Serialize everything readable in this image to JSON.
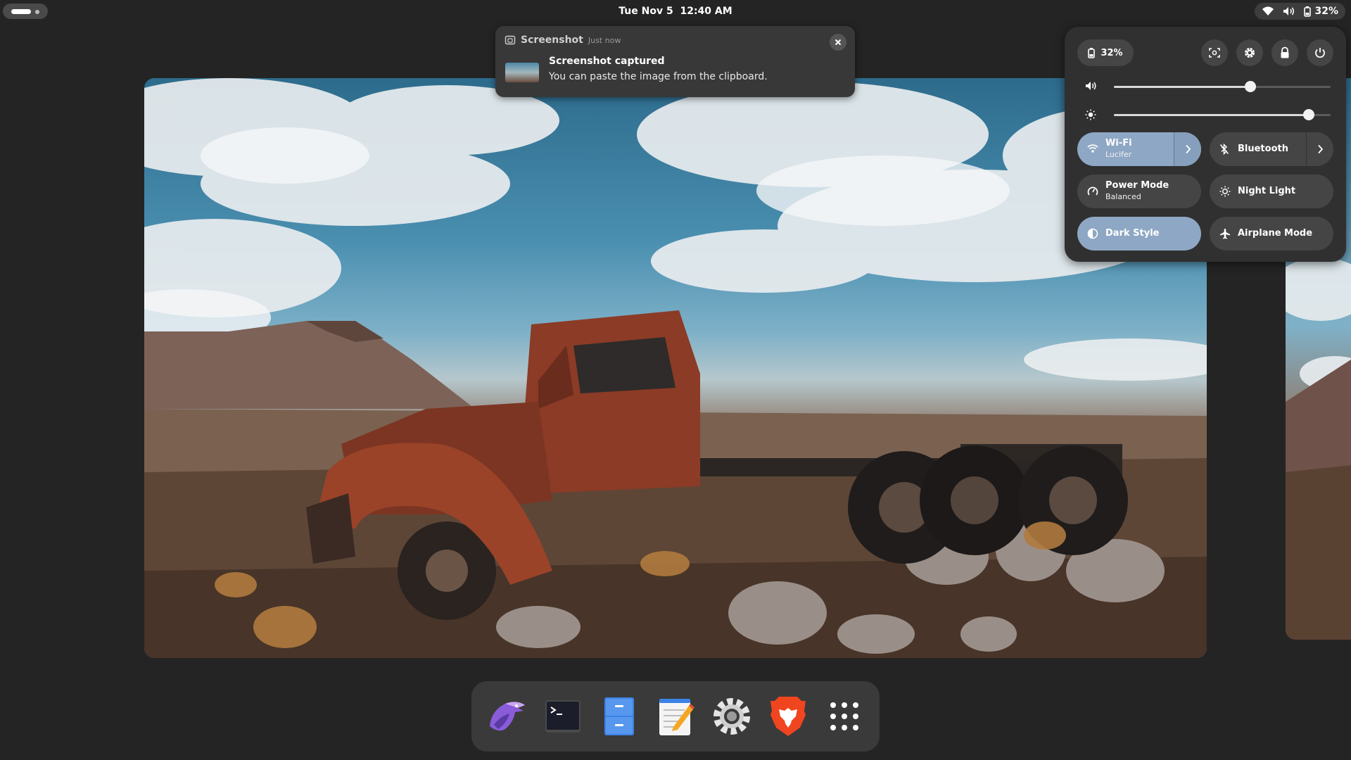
{
  "topbar": {
    "clock": "Tue Nov 5  12:40 AM",
    "battery_percent": "32%",
    "icons": [
      "wifi-icon",
      "volume-icon",
      "battery-icon"
    ]
  },
  "notification": {
    "app_name": "Screenshot",
    "time": "Just now",
    "title": "Screenshot captured",
    "body": "You can paste the image from the clipboard."
  },
  "quick_settings": {
    "battery_label": "32%",
    "actions": [
      "screenshot-icon",
      "settings-icon",
      "lock-icon",
      "power-icon"
    ],
    "volume_level": 0.63,
    "brightness_level": 0.9,
    "tiles": {
      "wifi": {
        "label": "Wi-Fi",
        "sub": "Lucifer",
        "on": true
      },
      "bluetooth": {
        "label": "Bluetooth",
        "on": false
      },
      "power_mode": {
        "label": "Power Mode",
        "sub": "Balanced",
        "on": false
      },
      "night_light": {
        "label": "Night Light",
        "on": false
      },
      "dark_style": {
        "label": "Dark Style",
        "on": true
      },
      "airplane_mode": {
        "label": "Airplane Mode",
        "on": false
      }
    },
    "accent_color": "#8ea7c4"
  },
  "dock": {
    "apps": [
      "eagle-app-icon",
      "terminal-icon",
      "file-cabinet-icon",
      "text-editor-icon",
      "settings-gear-icon",
      "brave-browser-icon",
      "app-grid-icon"
    ]
  }
}
